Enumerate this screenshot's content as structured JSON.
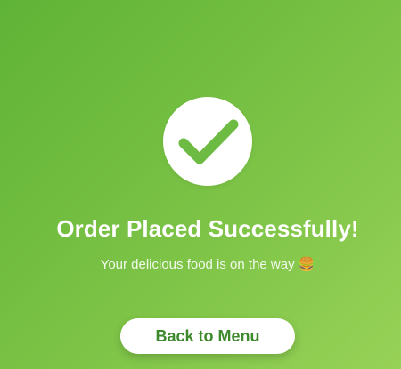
{
  "confirmation": {
    "icon": "checkmark-icon",
    "title": "Order Placed Successfully!",
    "message": "Your delicious food is on the way",
    "message_emoji": "🍔",
    "button_label": "Back to Menu"
  },
  "colors": {
    "background_start": "#5fb336",
    "background_end": "#97d257",
    "check_green": "#6dbb42",
    "button_text": "#3d8a2c",
    "white": "#ffffff"
  }
}
